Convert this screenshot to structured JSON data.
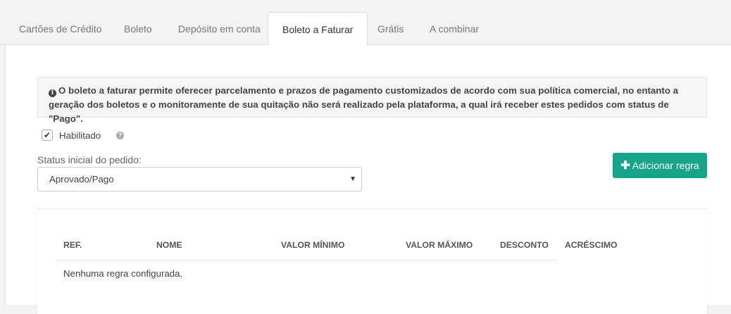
{
  "tabs": [
    {
      "label": "Cartões de Crédito",
      "active": false
    },
    {
      "label": "Boleto",
      "active": false
    },
    {
      "label": "Depósito em conta",
      "active": false
    },
    {
      "label": "Boleto a Faturar",
      "active": true
    },
    {
      "label": "Grátis",
      "active": false
    },
    {
      "label": "A combinar",
      "active": false
    }
  ],
  "info": {
    "icon": "info-circle-icon",
    "text": "O boleto a faturar permite oferecer parcelamento e prazos de pagamento customizados de acordo com sua política comercial, no entanto a geração dos boletos e o monitoramente de sua quitação não será realizado pela plataforma, a qual irá receber estes pedidos com status de \"Pago\"."
  },
  "enabled": {
    "label": "Habilitado",
    "checked": true,
    "help_icon": "question-circle-icon"
  },
  "status": {
    "label": "Status inicial do pedido:",
    "value": "Aprovado/Pago"
  },
  "add_rule": {
    "label": "Adicionar regra",
    "icon": "plus-icon",
    "color": "#17a589"
  },
  "table": {
    "columns": [
      "REF.",
      "NOME",
      "VALOR MÍNIMO",
      "VALOR MÁXIMO",
      "DESCONTO",
      "ACRÉSCIMO"
    ],
    "empty_text": "Nenhuma regra configurada."
  }
}
